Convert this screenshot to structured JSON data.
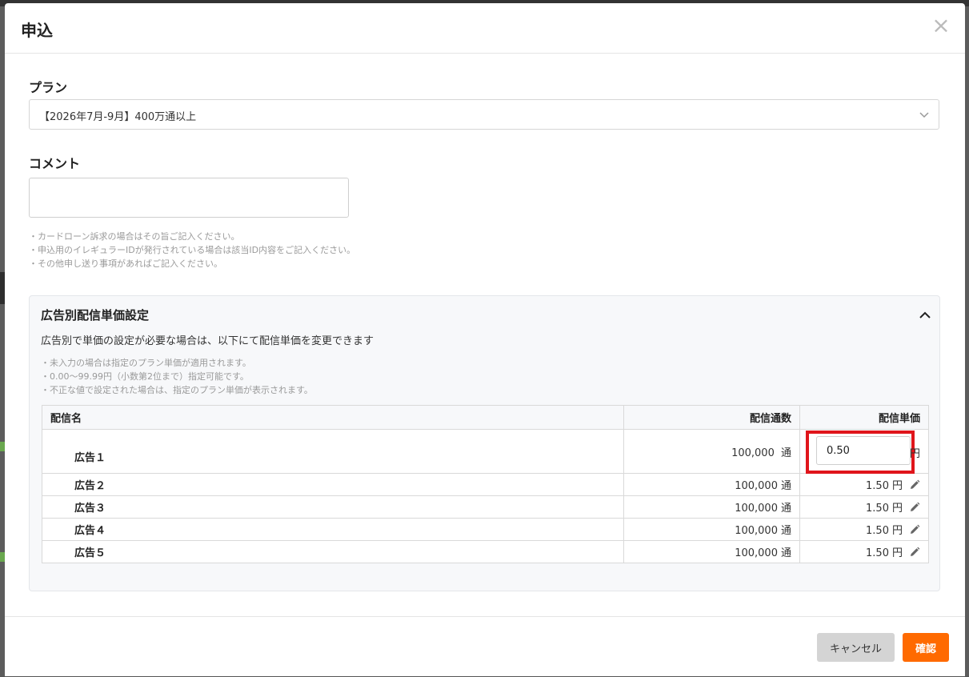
{
  "modal": {
    "title": "申込",
    "close_icon": "×"
  },
  "plan": {
    "label": "プラン",
    "selected": "【2026年7月-9月】400万通以上"
  },
  "comment": {
    "label": "コメント",
    "value": "",
    "notes": [
      "・カードローン訴求の場合はその旨ご記入ください。",
      "・申込用のイレギュラーIDが発行されている場合は該当ID内容をご記入ください。",
      "・その他申し送り事項があればご記入ください。"
    ]
  },
  "ad_pricing": {
    "title": "広告別配信単価設定",
    "description": "広告別で単価の設定が必要な場合は、以下にて配信単価を変更できます",
    "notes": [
      "・未入力の場合は指定のプラン単価が適用されます。",
      "・0.00〜99.99円（小数第2位まで）指定可能です。",
      "・不正な値で設定された場合は、指定のプラン単価が表示されます。"
    ],
    "columns": [
      "配信名",
      "配信通数",
      "配信単価"
    ],
    "rows": [
      {
        "name": "広告１",
        "count": "100,000",
        "count_unit": "通",
        "price": "0.50",
        "price_unit": "円"
      },
      {
        "name": "広告２",
        "count": "100,000",
        "count_unit": "通",
        "price": "1.50",
        "price_unit": "円"
      },
      {
        "name": "広告３",
        "count": "100,000",
        "count_unit": "通",
        "price": "1.50",
        "price_unit": "円"
      },
      {
        "name": "広告４",
        "count": "100,000",
        "count_unit": "通",
        "price": "1.50",
        "price_unit": "円"
      },
      {
        "name": "広告５",
        "count": "100,000",
        "count_unit": "通",
        "price": "1.50",
        "price_unit": "円"
      }
    ]
  },
  "footer": {
    "cancel_label": "キャンセル",
    "confirm_label": "確認"
  },
  "colors": {
    "accent": "#ff6a00",
    "highlight": "#e0151b",
    "cancel": "#d4d4d4"
  },
  "icons": {
    "close": "close-icon",
    "select": "chevron-down-icon",
    "panel_toggle": "chevron-up-icon",
    "edit": "pencil-icon"
  }
}
